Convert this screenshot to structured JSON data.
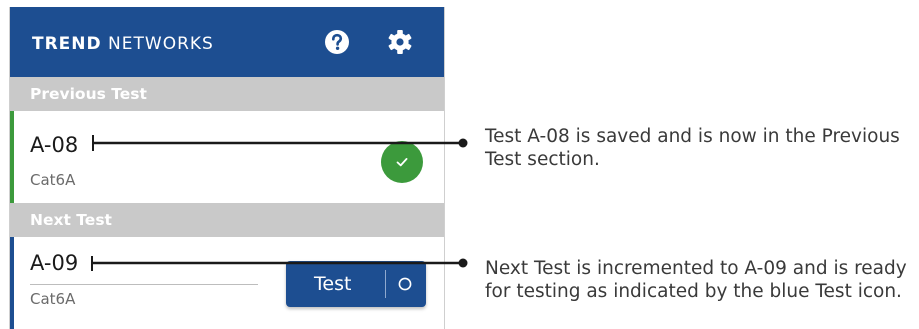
{
  "header": {
    "brand_bold": "TREND",
    "brand_rest": " NETWORKS",
    "help_icon": "help-circle-icon",
    "settings_icon": "gear-icon",
    "color": "#1d4e91"
  },
  "previous": {
    "section_label": "Previous Test",
    "id": "A-08",
    "cable": "Cat6A",
    "status_icon": "check-circle-icon",
    "accent_color": "#3c9a3c"
  },
  "next": {
    "section_label": "Next Test",
    "id": "A-09",
    "cable": "Cat6A",
    "accent_color": "#1d4e91",
    "test_button": {
      "label": "Test",
      "icon": "circle-icon"
    }
  },
  "callouts": [
    {
      "text": "Test A-08 is saved and is now in the Previous Test section."
    },
    {
      "text": "Next Test is incremented to A-09 and is ready for testing as indicated by the blue Test icon."
    }
  ]
}
